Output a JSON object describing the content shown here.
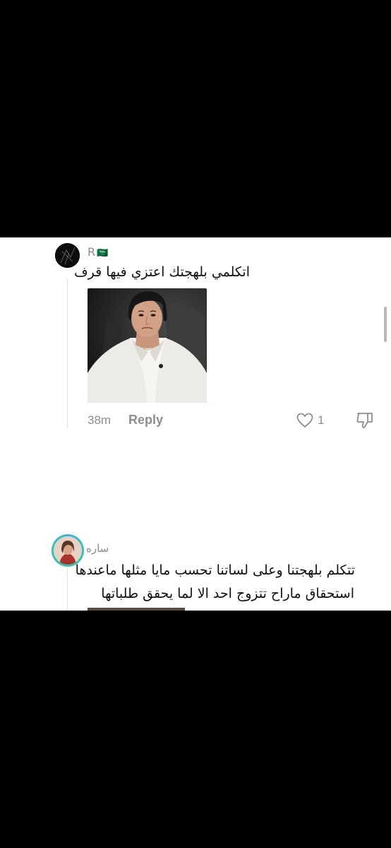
{
  "comments": [
    {
      "username": "R",
      "flag": "🇸🇦",
      "text": "اتكلمي بلهجتك اعتزي فيها قرف",
      "time": "38m",
      "reply_label": "Reply",
      "likes": "1"
    },
    {
      "username": "ساره",
      "text_line1": "تتكلم بلهجتنا وعلى لساتنا تحسب مايا مثلها ماعندها",
      "text_line2": "استحقاق ماراح تتزوج احد الا لما يحقق طلباتها"
    }
  ],
  "colors": {
    "background": "#000000",
    "panel": "#ffffff",
    "accent_ring": "#2fb7d6"
  }
}
